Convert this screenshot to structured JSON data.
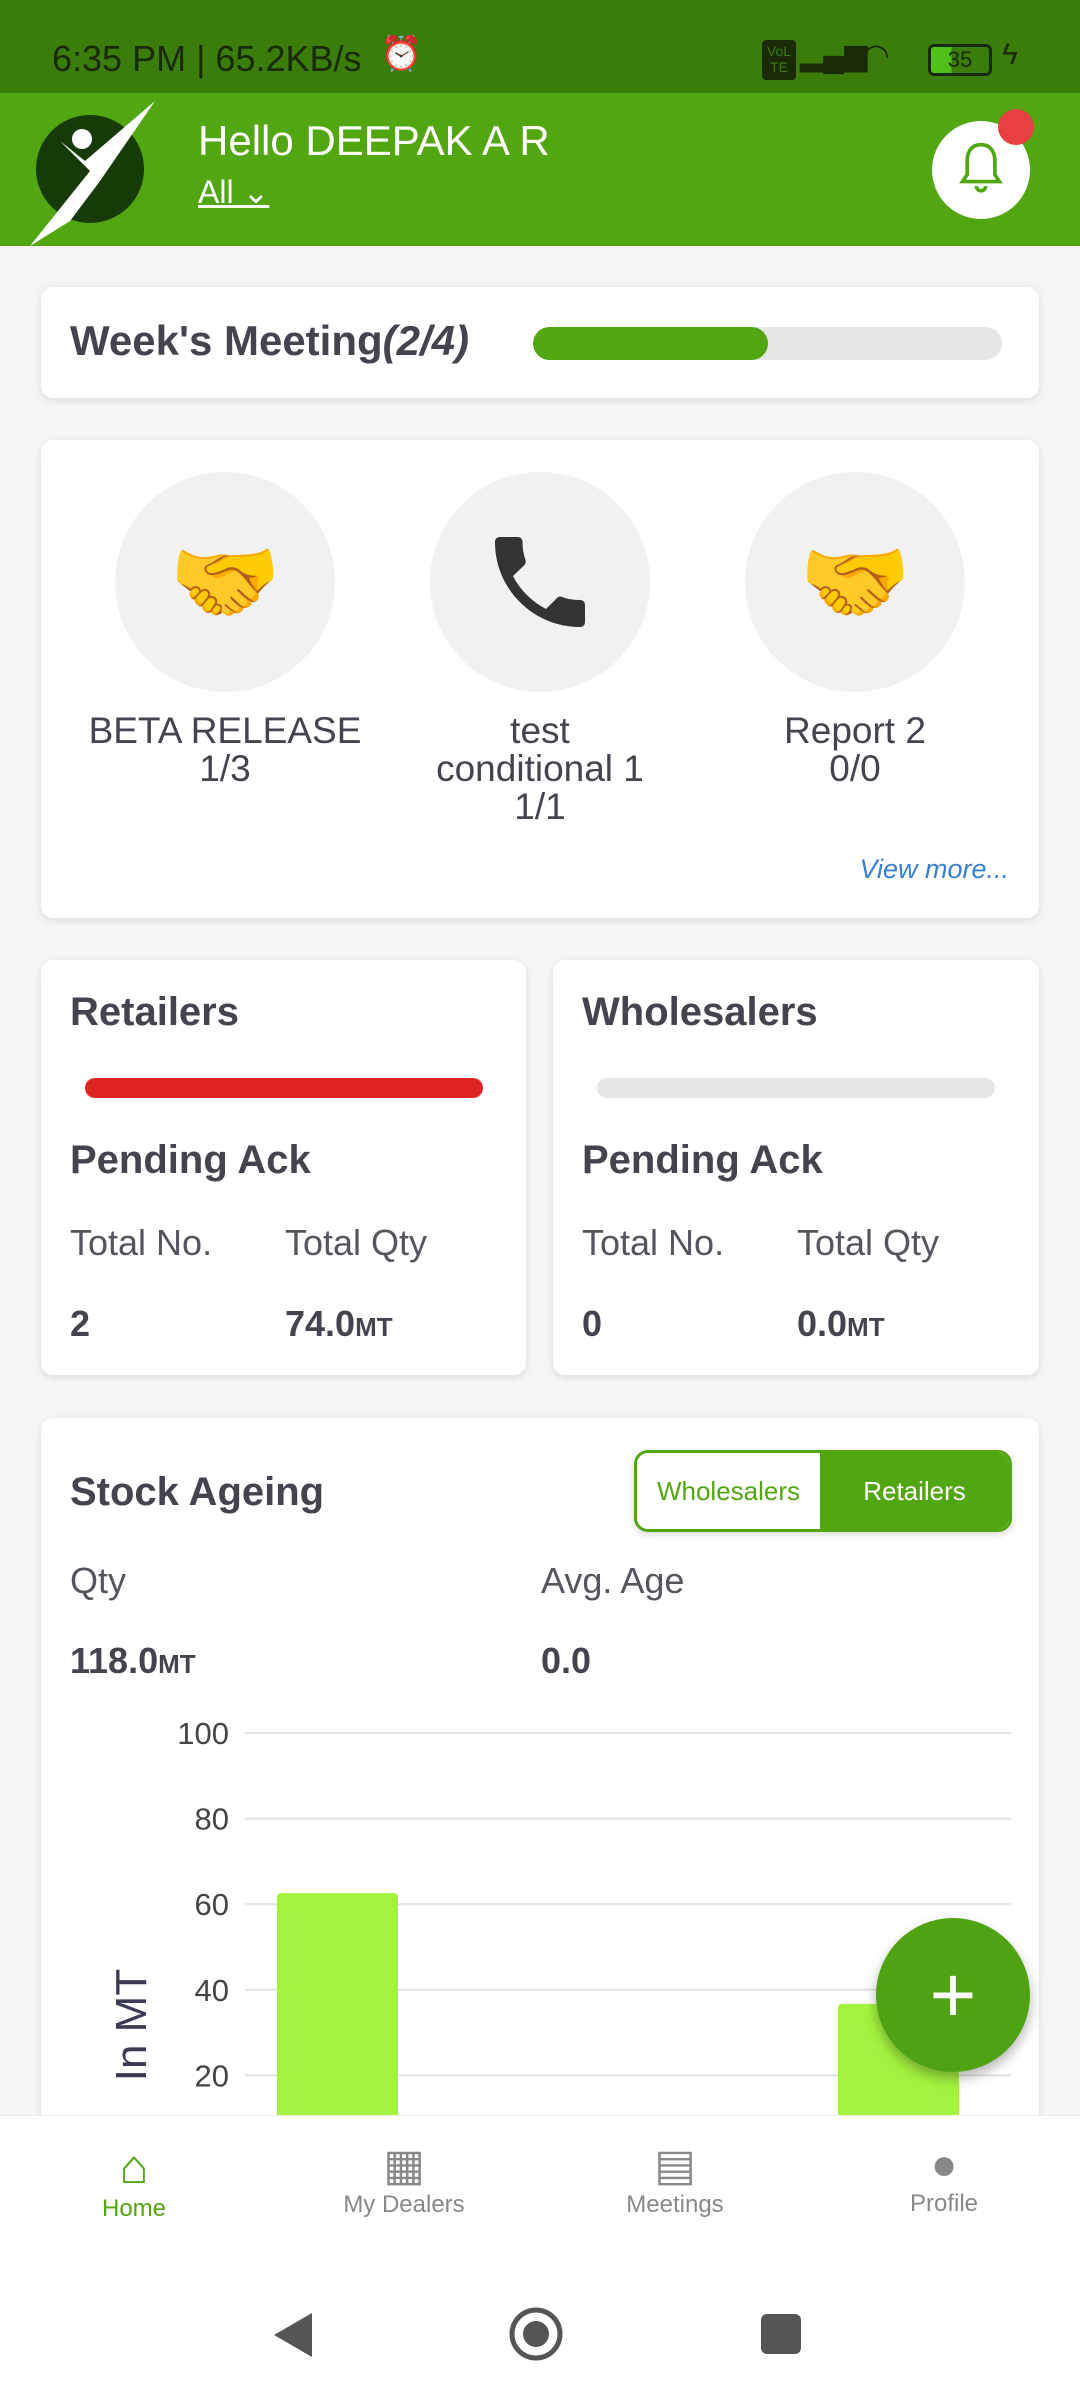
{
  "status_bar": {
    "time": "6:35 PM | 65.2KB/s",
    "battery": "35",
    "network": "VoLTE"
  },
  "header": {
    "greeting": "Hello DEEPAK A R",
    "filter": "All",
    "notification_dot": true
  },
  "weekly_meeting": {
    "title": "Week's Meeting",
    "count": "(2/4)",
    "progress": 0.5
  },
  "activities": [
    {
      "icon": "handshake-icon",
      "name": "BETA RELEASE",
      "count": "1/3"
    },
    {
      "icon": "phone-icon",
      "name": "test conditional 1",
      "count": "1/1"
    },
    {
      "icon": "handshake-icon",
      "name": "Report 2",
      "count": "0/0"
    }
  ],
  "view_more": "View more...",
  "pending": [
    {
      "title": "Retailers",
      "subtitle": "Pending Ack",
      "total_no_label": "Total No.",
      "total_qty_label": "Total Qty",
      "total_no": "2",
      "total_qty": "74.0",
      "unit": "MT",
      "bar_color": "#e02424"
    },
    {
      "title": "Wholesalers",
      "subtitle": "Pending Ack",
      "total_no_label": "Total No.",
      "total_qty_label": "Total Qty",
      "total_no": "0",
      "total_qty": "0.0",
      "unit": "MT",
      "bar_color": "#e6e6e6"
    }
  ],
  "stock_ageing": {
    "title": "Stock Ageing",
    "toggle": [
      "Wholesalers",
      "Retailers"
    ],
    "selected": "Retailers",
    "qty_label": "Qty",
    "qty": "118.0",
    "unit": "MT",
    "avg_age_label": "Avg. Age",
    "avg_age": "0.0"
  },
  "chart_data": {
    "type": "bar",
    "ylabel": "In MT",
    "ylim": [
      0,
      100
    ],
    "yticks": [
      "100",
      "80",
      "60",
      "40",
      "20"
    ],
    "values": [
      62.6,
      36.7
    ],
    "color": "#a3f23f",
    "grid": true
  },
  "bottom_nav": [
    {
      "label": "Home",
      "active": true
    },
    {
      "label": "My Dealers"
    },
    {
      "label": "Meetings"
    },
    {
      "label": "Profile"
    }
  ],
  "colors": {
    "brand": "#52a612",
    "status_bar": "#3b7d0b",
    "alert": "#e84040"
  }
}
